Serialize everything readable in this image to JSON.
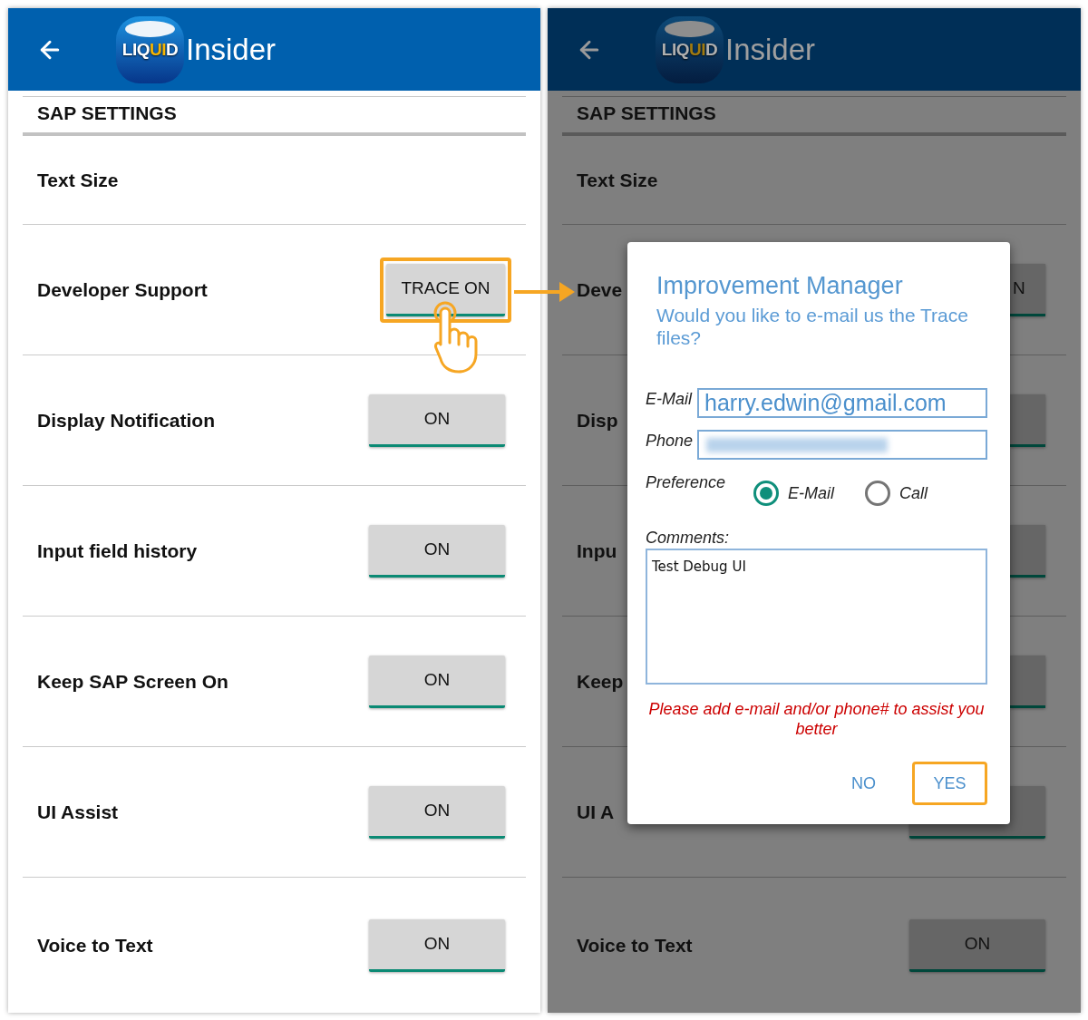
{
  "screens": [
    {
      "dimmed": false,
      "header": {
        "logo_parts": [
          {
            "text": "LIQ",
            "accent": false
          },
          {
            "text": "UI",
            "accent": true
          },
          {
            "text": "D",
            "accent": false
          }
        ],
        "title": "Insider"
      },
      "section_title": "SAP SETTINGS",
      "rows": [
        {
          "kind": "label",
          "label": "Text Size"
        },
        {
          "kind": "toggle",
          "label": "Developer Support",
          "button": "TRACE ON",
          "highlighted": true,
          "touch_pointer": true
        },
        {
          "kind": "toggle",
          "label": "Display Notification",
          "button": "ON"
        },
        {
          "kind": "toggle",
          "label": "Input field history",
          "button": "ON"
        },
        {
          "kind": "toggle",
          "label": "Keep SAP Screen On",
          "button": "ON"
        },
        {
          "kind": "toggle",
          "label": "UI Assist",
          "button": "ON"
        },
        {
          "kind": "toggle",
          "label": "Voice to Text",
          "button": "ON"
        }
      ]
    },
    {
      "dimmed": true,
      "header": {
        "logo_parts": [
          {
            "text": "LIQ",
            "accent": false
          },
          {
            "text": "UI",
            "accent": true
          },
          {
            "text": "D",
            "accent": false
          }
        ],
        "title": "Insider"
      },
      "section_title": "SAP SETTINGS",
      "rows": [
        {
          "kind": "label",
          "label": "Text Size"
        },
        {
          "kind": "edge",
          "label": "Deve",
          "button": "N"
        },
        {
          "kind": "edge",
          "label": "Disp"
        },
        {
          "kind": "edge",
          "label": "Inpu"
        },
        {
          "kind": "edge",
          "label": "Keep"
        },
        {
          "kind": "toggle",
          "label": "UI A"
        },
        {
          "kind": "toggle",
          "label": "Voice to Text",
          "button": "ON"
        }
      ],
      "dialog": {
        "title": "Improvement Manager",
        "message": "Would you like to e-mail us the Trace files?",
        "fields": [
          {
            "label": "E-Mail",
            "value": "harry.edwin@gmail.com"
          },
          {
            "label": "Phone",
            "redacted": true
          }
        ],
        "preference": {
          "label": "Preference",
          "options": [
            {
              "label": "E-Mail",
              "selected": true
            },
            {
              "label": "Call",
              "selected": false
            }
          ]
        },
        "comments": {
          "label": "Comments:",
          "value": "Test Debug UI"
        },
        "warning": "Please add e-mail and/or phone# to assist you better",
        "buttons": [
          {
            "label": "NO",
            "highlighted": false
          },
          {
            "label": "YES",
            "highlighted": true
          }
        ]
      }
    }
  ]
}
